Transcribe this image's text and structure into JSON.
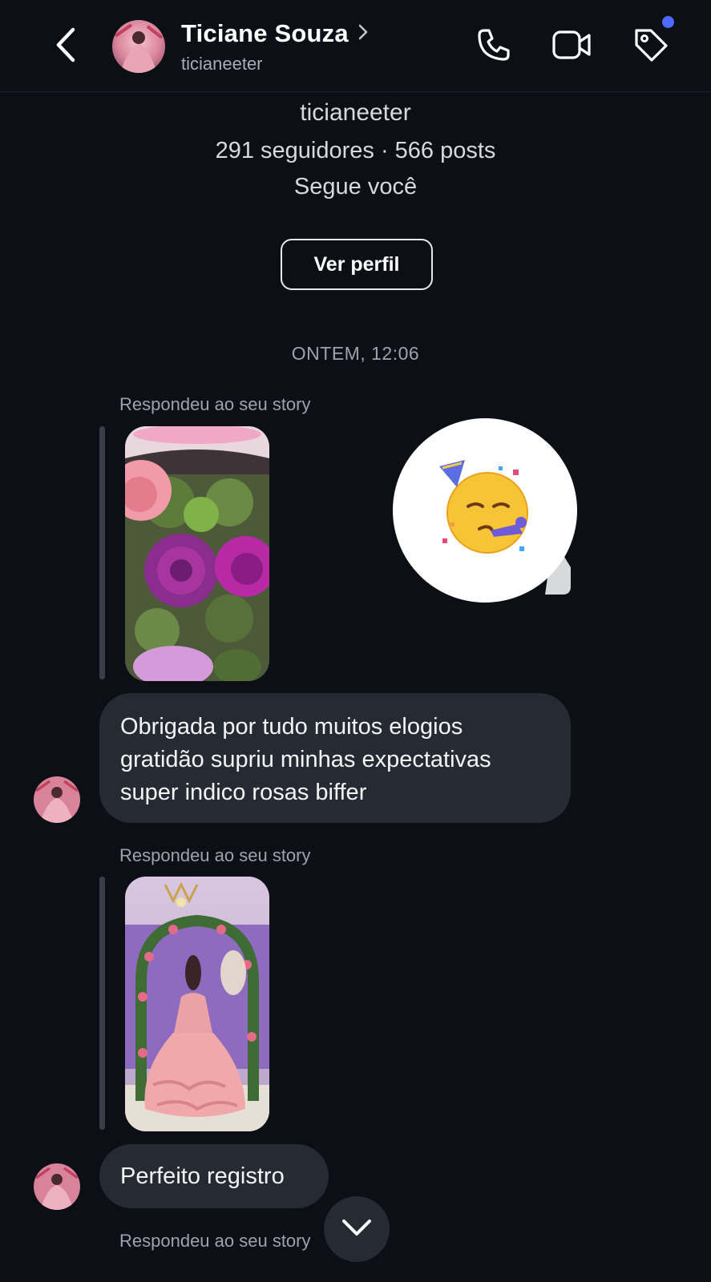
{
  "header": {
    "name": "Ticiane Souza",
    "handle": "ticianeeter",
    "icons": {
      "back": "chevron-left-icon",
      "profile_chevron": "chevron-right-icon",
      "call": "phone-icon",
      "video": "video-camera-icon",
      "tag": "tag-icon"
    },
    "notification_color": "#4f6bff"
  },
  "profile": {
    "username": "ticianeeter",
    "stats": "291 seguidores · 566 posts",
    "follows": "Segue você",
    "view_profile_label": "Ver perfil"
  },
  "thread": {
    "timestamp": "ONTEM, 12:06",
    "messages": [
      {
        "reply_label": "Respondeu ao seu story",
        "story": "flowers-story",
        "reaction": "partying-face-emoji",
        "text_lines": [
          "Obrigada por tudo  muitos elogios",
          "gratidão supriu minhas expectativas",
          "super indico rosas biffer"
        ]
      },
      {
        "reply_label": "Respondeu ao seu story",
        "story": "quinceanera-dress-story",
        "text": "Perfeito registro"
      },
      {
        "reply_label": "Respondeu ao seu story"
      }
    ]
  },
  "scroll_button_icon": "chevron-down-icon",
  "colors": {
    "background": "#0c0f16",
    "bubble": "#262a33",
    "muted_text": "#9ea2aa"
  }
}
